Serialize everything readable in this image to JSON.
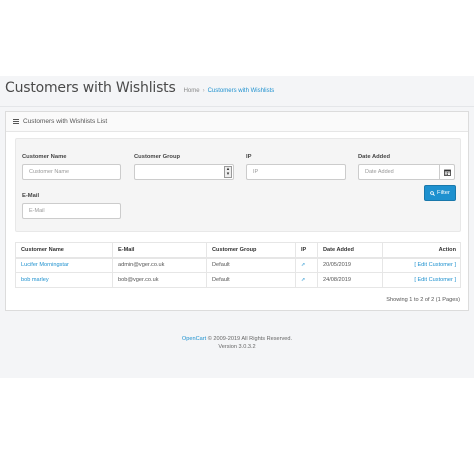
{
  "header": {
    "title": "Customers with Wishlists",
    "breadcrumb": {
      "home": "Home",
      "separator": "›",
      "current": "Customers with Wishlists"
    }
  },
  "panel": {
    "heading": "Customers with Wishlists List",
    "filters": {
      "customer_name": {
        "label": "Customer Name",
        "placeholder": "Customer Name"
      },
      "customer_group": {
        "label": "Customer Group",
        "value": ""
      },
      "ip": {
        "label": "IP",
        "placeholder": "IP"
      },
      "date_added": {
        "label": "Date Added",
        "placeholder": "Date Added"
      },
      "email": {
        "label": "E-Mail",
        "placeholder": "E-Mail"
      },
      "filter_button": "Filter"
    },
    "table": {
      "columns": [
        "Customer Name",
        "E-Mail",
        "Customer Group",
        "IP",
        "Date Added",
        "Action"
      ],
      "rows": [
        {
          "name": "Lucifer Morningstar",
          "email": "admin@vger.co.uk",
          "group": "Default",
          "ip": "⇗",
          "date": "20/05/2019",
          "action": "[ Edit Customer ]"
        },
        {
          "name": "bob marley",
          "email": "bob@vger.co.uk",
          "group": "Default",
          "ip": "⇗",
          "date": "24/08/2019",
          "action": "[ Edit Customer ]"
        }
      ]
    },
    "pagination_info": "Showing 1 to 2 of 2 (1 Pages)"
  },
  "footer": {
    "brand": "OpenCart",
    "copyright": "© 2009-2019 All Rights Reserved.",
    "version": "Version 3.0.3.2"
  },
  "colors": {
    "accent": "#1e91cf",
    "background": "#f4f5f7",
    "text": "#555555"
  },
  "icons": {
    "list": "list-icon",
    "calendar": "calendar-icon",
    "filter": "search-icon",
    "dropdown": "chevron-down-icon",
    "ip": "external-link-icon"
  }
}
